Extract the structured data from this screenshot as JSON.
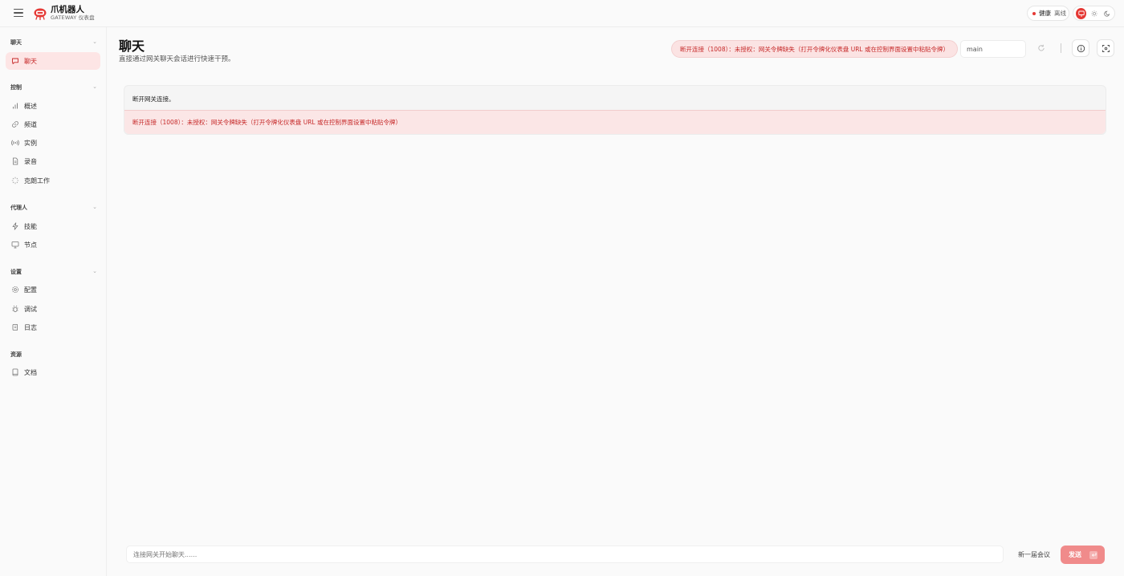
{
  "brand": {
    "name": "爪机器人",
    "subtitle": "GATEWAY 仪表盘"
  },
  "header": {
    "health_label": "健康",
    "health_status": "离线"
  },
  "sidebar": {
    "groups": [
      {
        "title": "聊天",
        "items": [
          {
            "label": "聊天",
            "icon": "chat-icon",
            "active": true
          }
        ]
      },
      {
        "title": "控制",
        "items": [
          {
            "label": "概述",
            "icon": "bar-chart-icon"
          },
          {
            "label": "频道",
            "icon": "link-icon"
          },
          {
            "label": "实例",
            "icon": "broadcast-icon"
          },
          {
            "label": "录音",
            "icon": "document-icon"
          },
          {
            "label": "克朗工作",
            "icon": "loader-icon"
          }
        ]
      },
      {
        "title": "代理人",
        "items": [
          {
            "label": "技能",
            "icon": "bolt-icon"
          },
          {
            "label": "节点",
            "icon": "monitor-icon"
          }
        ]
      },
      {
        "title": "设置",
        "items": [
          {
            "label": "配置",
            "icon": "gear-icon"
          },
          {
            "label": "调试",
            "icon": "bug-icon"
          },
          {
            "label": "日志",
            "icon": "scroll-icon"
          }
        ]
      },
      {
        "title": "资源",
        "items": [
          {
            "label": "文档",
            "icon": "book-icon"
          }
        ]
      }
    ]
  },
  "main": {
    "title": "聊天",
    "subtitle": "直接通过网关聊天会话进行快速干预。",
    "error_pill": "断开连接（1008）：未授权：网关令牌缺失（打开令牌化仪表盘 URL 或在控制界面设置中粘贴令牌）",
    "session_value": "main",
    "panel_message": "断开网关连接。",
    "panel_error": "断开连接（1008）：未授权：网关令牌缺失（打开令牌化仪表盘 URL 或在控制界面设置中粘贴令牌）",
    "input_placeholder": "连接网关开始聊天......",
    "new_session_label": "新一届会议",
    "send_label": "发送"
  },
  "colors": {
    "accent": "#e53935",
    "error_text": "#c62828",
    "error_bg": "#fbe3e3"
  }
}
